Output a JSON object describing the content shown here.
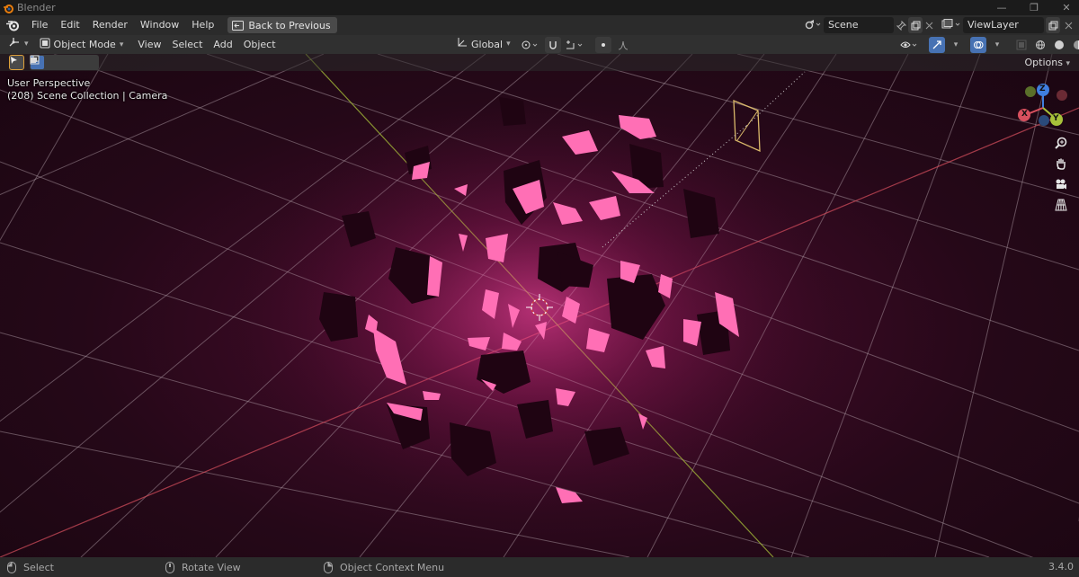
{
  "window": {
    "title": "Blender",
    "controls": [
      "—",
      "❐",
      "✕"
    ]
  },
  "menubar": {
    "items": [
      "File",
      "Edit",
      "Render",
      "Window",
      "Help"
    ],
    "back_button": "Back to Previous",
    "scene": "Scene",
    "view_layer": "ViewLayer"
  },
  "header": {
    "mode": "Object Mode",
    "menus": [
      "View",
      "Select",
      "Add",
      "Object"
    ],
    "orientation": "Global"
  },
  "tool_header": {
    "options": "Options"
  },
  "viewport": {
    "perspective": "User Perspective",
    "collection_info": "(208) Scene Collection | Camera",
    "gizmo_axes": [
      "Z",
      "X",
      "Y"
    ]
  },
  "statusbar": {
    "select": "Select",
    "rotate": "Rotate View",
    "context_menu": "Object Context Menu",
    "version": "3.4.0"
  },
  "colors": {
    "accent": "#4772b3",
    "shard_glow": "#ff6fb5",
    "shard_dark": "#1f0412",
    "grid": "#b9a6b0",
    "x_axis": "#d8505e",
    "y_axis": "#a8c23a",
    "z_axis": "#3f7fe0"
  }
}
